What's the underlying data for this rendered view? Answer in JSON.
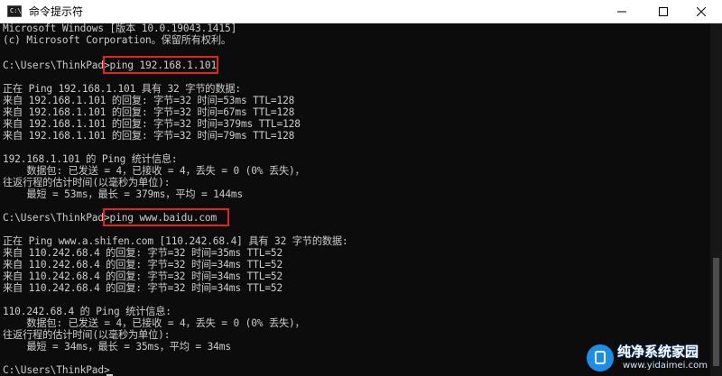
{
  "window": {
    "title": "命令提示符",
    "icon_text": "C:\\",
    "buttons": {
      "minimize": "minimize-icon",
      "maximize": "maximize-icon",
      "close": "close-icon"
    }
  },
  "console": {
    "lines": [
      "Microsoft Windows [版本 10.0.19043.1415]",
      "(c) Microsoft Corporation。保留所有权利。",
      "",
      "C:\\Users\\ThinkPad>ping 192.168.1.101",
      "",
      "正在 Ping 192.168.1.101 具有 32 字节的数据:",
      "来自 192.168.1.101 的回复: 字节=32 时间=53ms TTL=128",
      "来自 192.168.1.101 的回复: 字节=32 时间=67ms TTL=128",
      "来自 192.168.1.101 的回复: 字节=32 时间=379ms TTL=128",
      "来自 192.168.1.101 的回复: 字节=32 时间=79ms TTL=128",
      "",
      "192.168.1.101 的 Ping 统计信息:",
      "    数据包: 已发送 = 4，已接收 = 4，丢失 = 0 (0% 丢失)，",
      "往返行程的估计时间(以毫秒为单位):",
      "    最短 = 53ms，最长 = 379ms，平均 = 144ms",
      "",
      "C:\\Users\\ThinkPad>ping www.baidu.com",
      "",
      "正在 Ping www.a.shifen.com [110.242.68.4] 具有 32 字节的数据:",
      "来自 110.242.68.4 的回复: 字节=32 时间=35ms TTL=52",
      "来自 110.242.68.4 的回复: 字节=32 时间=34ms TTL=52",
      "来自 110.242.68.4 的回复: 字节=32 时间=34ms TTL=52",
      "来自 110.242.68.4 的回复: 字节=32 时间=34ms TTL=52",
      "",
      "110.242.68.4 的 Ping 统计信息:",
      "    数据包: 已发送 = 4，已接收 = 4，丢失 = 0 (0% 丢失)，",
      "往返行程的估计时间(以毫秒为单位):",
      "    最短 = 34ms，最长 = 35ms，平均 = 34ms",
      "",
      "C:\\Users\\ThinkPad>"
    ],
    "text_color": "#cccccc",
    "background": "#0c0c0c",
    "highlight_color": "#e0261d"
  },
  "watermark": {
    "title": "纯净系统家园",
    "url": "www.yidaimei.com",
    "icon": "logo-icon"
  }
}
